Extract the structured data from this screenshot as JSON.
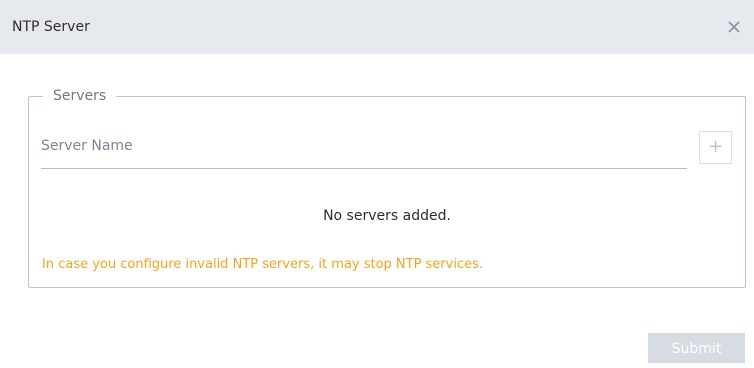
{
  "dialog": {
    "title": "NTP Server",
    "close_icon": "close-icon"
  },
  "servers": {
    "legend": "Servers",
    "input_placeholder": "Server Name",
    "input_value": "",
    "add_label": "+",
    "empty_message": "No servers added.",
    "warning": "In case you configure invalid NTP servers, it may stop NTP services."
  },
  "footer": {
    "submit_label": "Submit"
  },
  "colors": {
    "header_bg": "#e6eaef",
    "warning": "#f2a41c",
    "border": "#b8c6d4",
    "submit_disabled_bg": "#d7dce2"
  }
}
